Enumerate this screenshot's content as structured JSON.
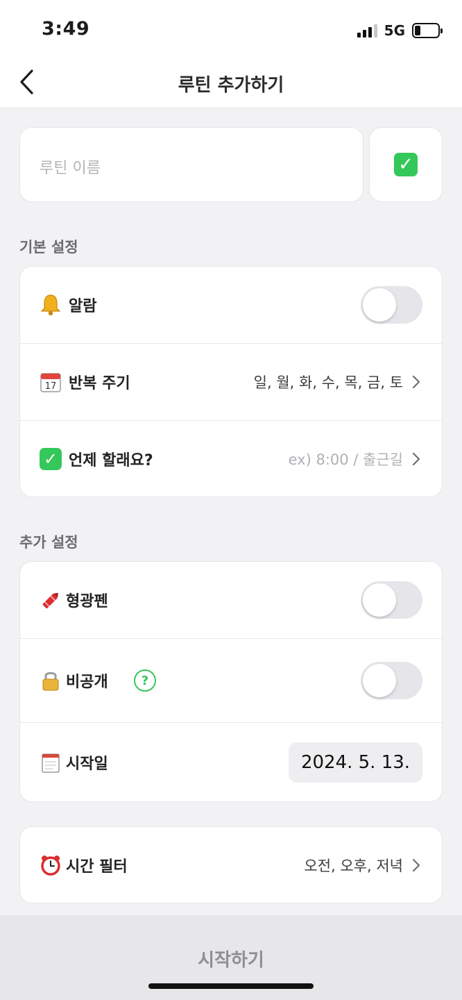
{
  "status_bar": {
    "time": "3:49",
    "network": "5G",
    "battery_level": 0.25
  },
  "nav": {
    "title": "루틴 추가하기",
    "back_icon": "chevron-left-icon"
  },
  "routine_name": {
    "placeholder": "루틴 이름",
    "emoji_button_icon": "✓"
  },
  "basic_settings": {
    "label": "기본 설정",
    "alarm": {
      "icon": "bell-icon",
      "label": "알람",
      "enabled": false
    },
    "repeat": {
      "icon": "calendar-icon",
      "label": "반복 주기",
      "value": "일, 월, 화, 수, 목, 금, 토"
    },
    "when": {
      "icon": "check-icon",
      "label": "언제 할래요?",
      "value": "ex) 8:00 / 출근길"
    }
  },
  "extra_settings": {
    "label": "추가 설정",
    "highlighter": {
      "icon": "crayon-icon",
      "label": "형광펜",
      "enabled": false
    },
    "private": {
      "icon": "lock-icon",
      "label": "비공개",
      "help": "?",
      "enabled": false
    },
    "start_date": {
      "icon": "notepad-icon",
      "label": "시작일",
      "value": "2024. 5. 13."
    }
  },
  "time_filter": {
    "icon": "alarm-clock-icon",
    "label": "시간 필터",
    "value": "오전, 오후, 저녁"
  },
  "footer": {
    "start_label": "시작하기"
  },
  "colors": {
    "accent_green": "#34c759",
    "toggle_off": "#e5e5ea",
    "background": "#f2f2f4"
  }
}
